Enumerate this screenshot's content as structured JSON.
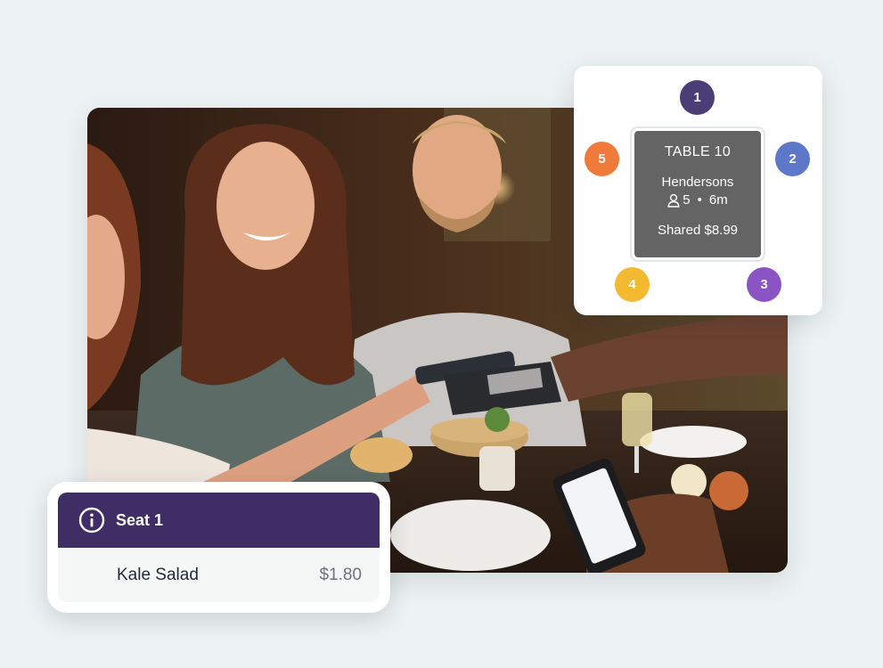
{
  "table_card": {
    "table_label": "TABLE 10",
    "party_name": "Hendersons",
    "guest_count": "5",
    "separator": "•",
    "duration": "6m",
    "shared_total": "Shared $8.99",
    "seats": [
      {
        "number": "1",
        "color": "#4b3d75"
      },
      {
        "number": "2",
        "color": "#5d78c9"
      },
      {
        "number": "3",
        "color": "#8a54c4"
      },
      {
        "number": "4",
        "color": "#f2b931"
      },
      {
        "number": "5",
        "color": "#ef7a3a"
      }
    ]
  },
  "seat_card": {
    "title": "Seat 1",
    "item_name": "Kale Salad",
    "item_price": "$1.80",
    "header_color": "#3f2d66"
  },
  "photo": {
    "icon": "restaurant-photo"
  }
}
